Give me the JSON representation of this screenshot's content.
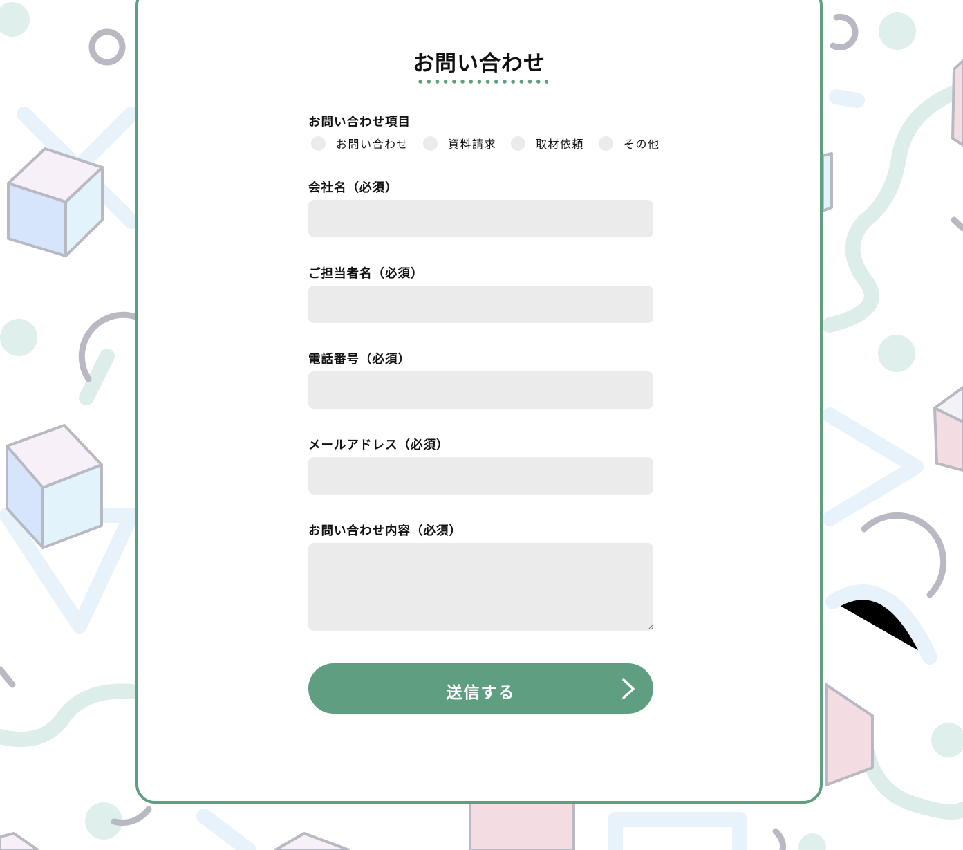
{
  "form": {
    "title": "お問い合わせ",
    "inquiry_type": {
      "label": "お問い合わせ項目",
      "options": [
        "お問い合わせ",
        "資料請求",
        "取材依頼",
        "その他"
      ]
    },
    "company": {
      "label": "会社名（必須）",
      "value": "",
      "placeholder": ""
    },
    "person": {
      "label": "ご担当者名（必須）",
      "value": "",
      "placeholder": ""
    },
    "phone": {
      "label": "電話番号（必須）",
      "value": "",
      "placeholder": ""
    },
    "email": {
      "label": "メールアドレス（必須）",
      "value": "",
      "placeholder": ""
    },
    "message": {
      "label": "お問い合わせ内容（必須）",
      "value": "",
      "placeholder": ""
    },
    "submit_label": "送信する",
    "submit_icon": "chevron-right-icon"
  },
  "colors": {
    "accent": "#5f9e80",
    "input_bg": "#ebebeb",
    "text": "#111111"
  },
  "background": {
    "pattern_icons": [
      "cube-icon",
      "ring-icon",
      "dot-icon",
      "arc-icon",
      "squiggle-icon",
      "triangle-icon",
      "cross-icon"
    ]
  }
}
